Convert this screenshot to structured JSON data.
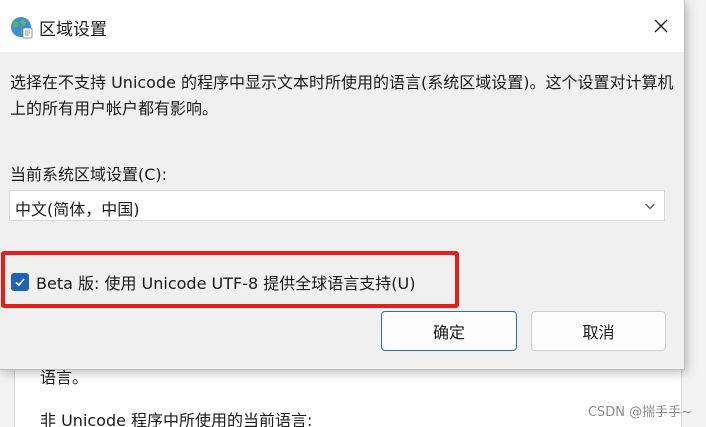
{
  "dialog": {
    "title": "区域设置",
    "description": "选择在不支持 Unicode 的程序中显示文本时所使用的语言(系统区域设置)。这个设置对计算机上的所有用户帐户都有影响。",
    "locale_label": "当前系统区域设置(C):",
    "locale_value": "中文(简体，中国)",
    "beta_label": "Beta 版: 使用 Unicode UTF-8 提供全球语言支持(U)",
    "beta_checked": true,
    "ok_label": "确定",
    "cancel_label": "取消",
    "icons": {
      "title": "globe-icon",
      "close": "close-icon",
      "dropdown": "chevron-down-icon",
      "check": "checkmark-icon"
    }
  },
  "background": {
    "text_line1": "语言。",
    "text_line2": "非 Unicode 程序中所使用的当前语言:"
  },
  "watermark": "CSDN @揣手手~",
  "colors": {
    "highlight": "#e3201b",
    "accent": "#1e63b4"
  }
}
